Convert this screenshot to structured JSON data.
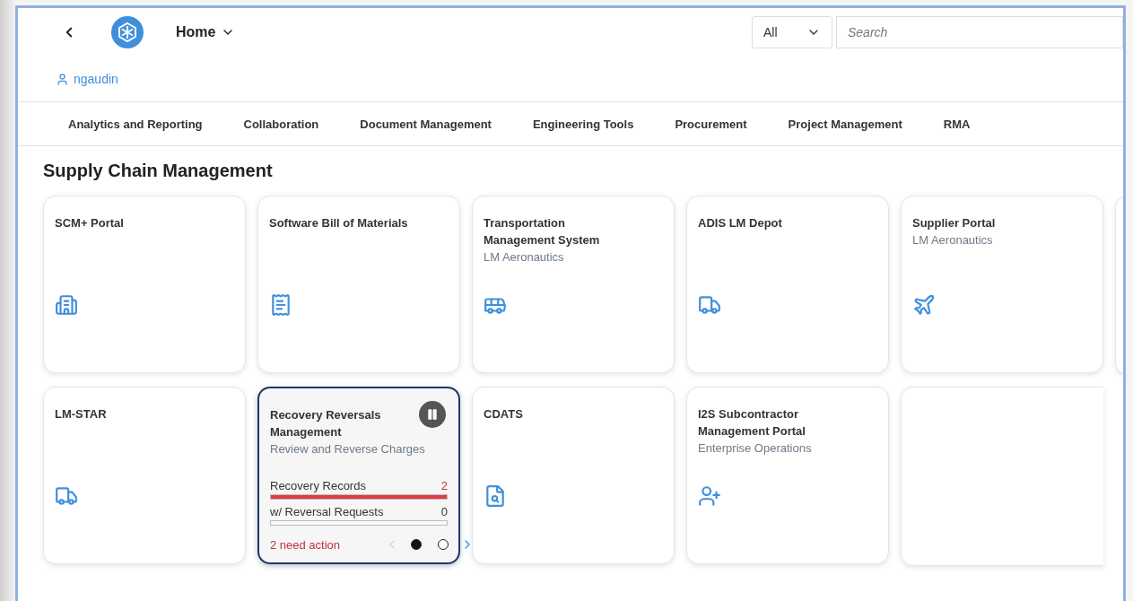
{
  "header": {
    "home_menu": "Home",
    "scope_select": "All",
    "search": {
      "placeholder": "Search"
    },
    "user": "ngaudin"
  },
  "nav_tabs": [
    {
      "label": "Analytics and Reporting"
    },
    {
      "label": "Collaboration"
    },
    {
      "label": "Document Management"
    },
    {
      "label": "Engineering Tools"
    },
    {
      "label": "Procurement"
    },
    {
      "label": "Project Management"
    },
    {
      "label": "RMA"
    }
  ],
  "section": {
    "title": "Supply Chain Management",
    "tiles": [
      {
        "kind": "app",
        "title": "SCM+ Portal"
      },
      {
        "kind": "app",
        "title": "Software Bill of Materials"
      },
      {
        "kind": "app",
        "title": "Transportation Management System",
        "subtitle": "LM Aeronautics"
      },
      {
        "kind": "app",
        "title": "ADIS LM Depot"
      },
      {
        "kind": "app",
        "title": "Supplier Portal",
        "subtitle": "LM Aeronautics"
      },
      {
        "kind": "partial"
      },
      {
        "kind": "app",
        "title": "LM-STAR"
      },
      {
        "kind": "dynamic",
        "title": "Recovery Reversals Management",
        "subtitle": "Review and Reverse Charges",
        "metrics": [
          {
            "label": "Recovery Records",
            "value": "2",
            "level": 1,
            "alert": true
          },
          {
            "label": "w/ Reversal Requests",
            "value": "0",
            "level": 0,
            "alert": false
          }
        ],
        "footer": "2 need action",
        "prev_disabled": true,
        "pages": [
          {
            "selected": true
          },
          {
            "selected": false
          }
        ]
      },
      {
        "kind": "app",
        "title": "CDATS"
      },
      {
        "kind": "app",
        "title": "I2S Subcontractor Management Portal",
        "subtitle": "Enterprise Operations"
      },
      {
        "kind": "partial"
      }
    ]
  }
}
